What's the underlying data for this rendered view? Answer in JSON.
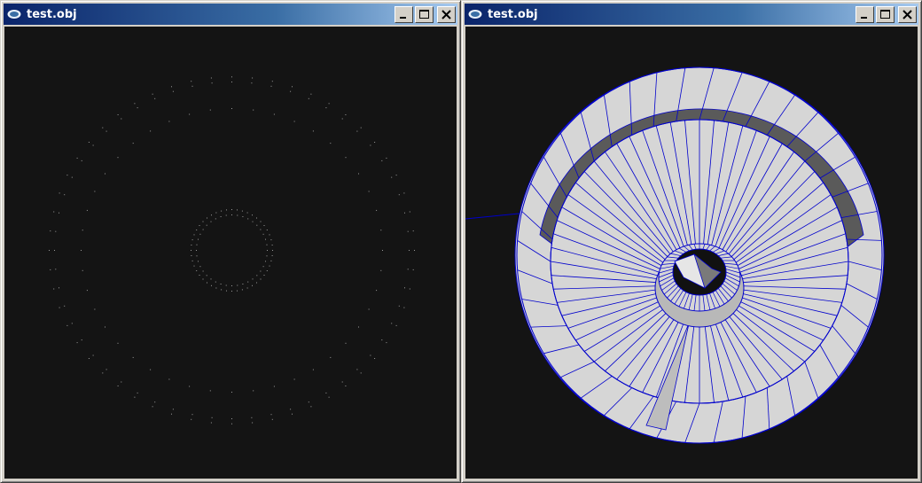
{
  "windows": [
    {
      "id": "left",
      "title": "test.obj",
      "render_mode": "points",
      "background": "#141414",
      "point_color": "#9a9a9a"
    },
    {
      "id": "right",
      "title": "test.obj",
      "render_mode": "shaded-wireframe",
      "background": "#141414",
      "surface_color": "#d6d6d6",
      "wire_color": "#0000cc"
    }
  ],
  "title_controls": [
    "minimize-icon",
    "maximize-icon",
    "close-icon"
  ],
  "colors": {
    "titlebar_start": "#0a246a",
    "titlebar_end": "#a6caf0",
    "frame": "#d4d0c8"
  }
}
